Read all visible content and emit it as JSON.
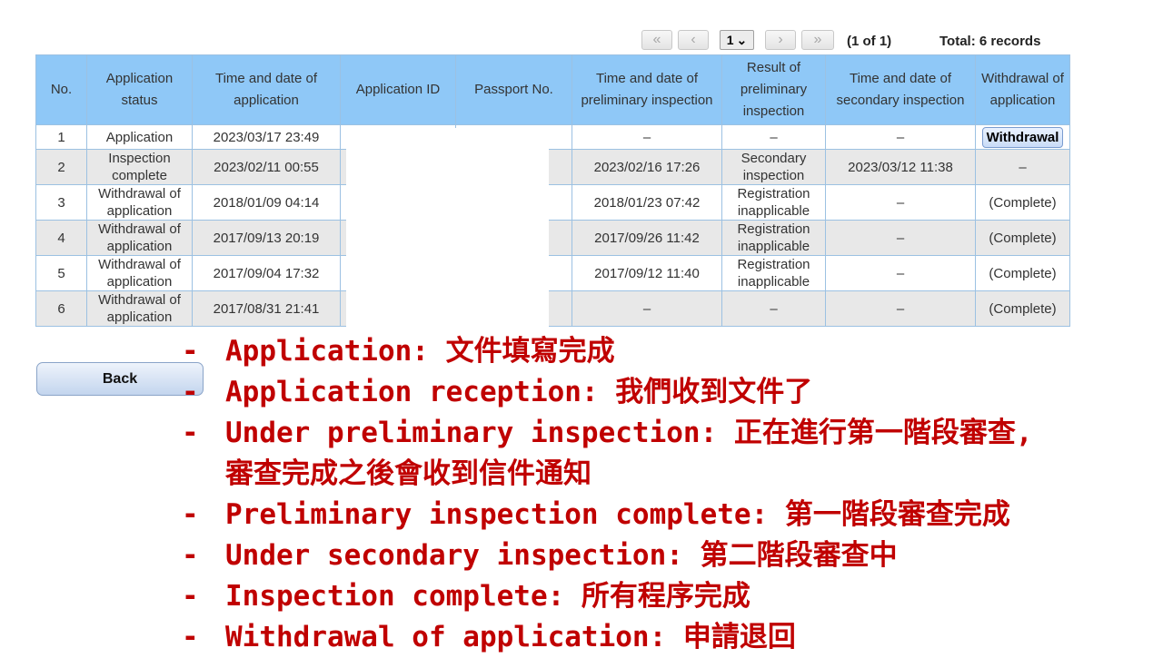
{
  "pager": {
    "first": "«",
    "prev": "‹",
    "page": "1",
    "chevron": "⌄",
    "next": "›",
    "last": "»",
    "info": "(1 of 1)",
    "total": "Total: 6 records"
  },
  "table": {
    "headers": [
      "No.",
      "Application status",
      "Time and date of application",
      "Application ID",
      "Passport No.",
      "Time and date of preliminary inspection",
      "Result of preliminary inspection",
      "Time and date of secondary inspection",
      "Withdrawal of application"
    ],
    "rows": [
      {
        "no": "1",
        "status": "Application",
        "applied": "2023/03/17 23:49",
        "app_id": "",
        "passport": "",
        "pre_time": "–",
        "pre_result": "–",
        "sec_time": "–",
        "withdrawal": "Withdrawal"
      },
      {
        "no": "2",
        "status": "Inspection complete",
        "applied": "2023/02/11 00:55",
        "app_id": "",
        "passport": "",
        "pre_time": "2023/02/16 17:26",
        "pre_result": "Secondary inspection",
        "sec_time": "2023/03/12 11:38",
        "withdrawal": "–"
      },
      {
        "no": "3",
        "status": "Withdrawal of application",
        "applied": "2018/01/09 04:14",
        "app_id": "",
        "passport": "",
        "pre_time": "2018/01/23 07:42",
        "pre_result": "Registration inapplicable",
        "sec_time": "–",
        "withdrawal": "(Complete)"
      },
      {
        "no": "4",
        "status": "Withdrawal of application",
        "applied": "2017/09/13 20:19",
        "app_id": "",
        "passport": "",
        "pre_time": "2017/09/26 11:42",
        "pre_result": "Registration inapplicable",
        "sec_time": "–",
        "withdrawal": "(Complete)"
      },
      {
        "no": "5",
        "status": "Withdrawal of application",
        "applied": "2017/09/04 17:32",
        "app_id": "",
        "passport": "",
        "pre_time": "2017/09/12 11:40",
        "pre_result": "Registration inapplicable",
        "sec_time": "–",
        "withdrawal": "(Complete)"
      },
      {
        "no": "6",
        "status": "Withdrawal of application",
        "applied": "2017/08/31 21:41",
        "app_id": "",
        "passport": "",
        "pre_time": "–",
        "pre_result": "–",
        "sec_time": "–",
        "withdrawal": "(Complete)"
      }
    ]
  },
  "back_label": "Back",
  "notes": {
    "dash": "-",
    "items": [
      "Application: 文件填寫完成",
      "Application reception: 我們收到文件了",
      "Under preliminary inspection: 正在進行第一階段審查,",
      "Preliminary inspection complete: 第一階段審查完成",
      "Under secondary inspection: 第二階段審查中",
      "Inspection complete: 所有程序完成",
      "Withdrawal of application: 申請退回"
    ],
    "item3_cont": "審查完成之後會收到信件通知"
  },
  "colors": {
    "header_bg": "#8fc8f7",
    "note_red": "#c00000",
    "row_alt": "#e8e8e8"
  }
}
